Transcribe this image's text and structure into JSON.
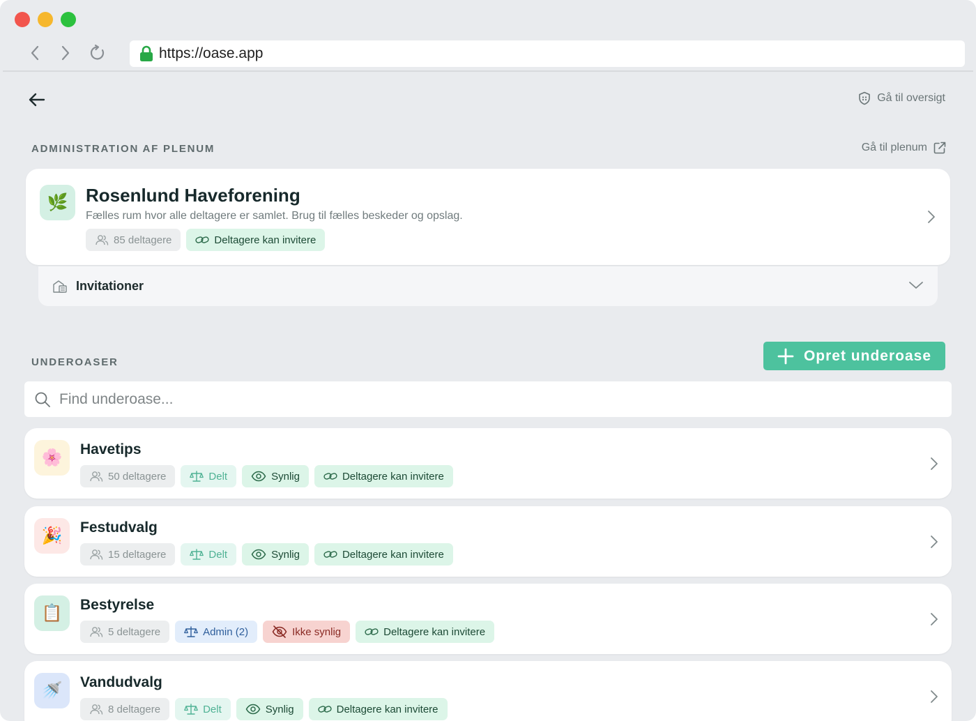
{
  "browser": {
    "url": "https://oase.app"
  },
  "header": {
    "overview_link": "Gå til oversigt"
  },
  "admin_section": {
    "label": "ADMINISTRATION AF PLENUM",
    "plenum_link": "Gå til plenum",
    "card": {
      "icon": "🌿",
      "title": "Rosenlund Haveforening",
      "description": "Fælles rum hvor alle deltagere er samlet. Brug til fælles beskeder og opslag.",
      "participants": "85 deltagere",
      "invite": "Deltagere kan invitere"
    },
    "invitations_label": "Invitationer"
  },
  "sub_section": {
    "label": "UNDEROASER",
    "create_button": "Opret underoase",
    "search_placeholder": "Find underoase..."
  },
  "subs": [
    {
      "icon": "🌸",
      "icon_bg": "#fdf4dc",
      "title": "Havetips",
      "participants": "50 deltagere",
      "role": "Delt",
      "visibility": "Synlig",
      "invite": "Deltagere kan invitere"
    },
    {
      "icon": "🎉",
      "icon_bg": "#fde8e6",
      "title": "Festudvalg",
      "participants": "15 deltagere",
      "role": "Delt",
      "visibility": "Synlig",
      "invite": "Deltagere kan invitere"
    },
    {
      "icon": "📋",
      "icon_bg": "#d4f0e4",
      "title": "Bestyrelse",
      "participants": "5 deltagere",
      "role": "Admin (2)",
      "visibility": "Ikke synlig",
      "invite": "Deltagere kan invitere"
    },
    {
      "icon": "🚿",
      "icon_bg": "#dbe6fa",
      "title": "Vandudvalg",
      "participants": "8 deltagere",
      "role": "Delt",
      "visibility": "Synlig",
      "invite": "Deltagere kan invitere"
    }
  ]
}
